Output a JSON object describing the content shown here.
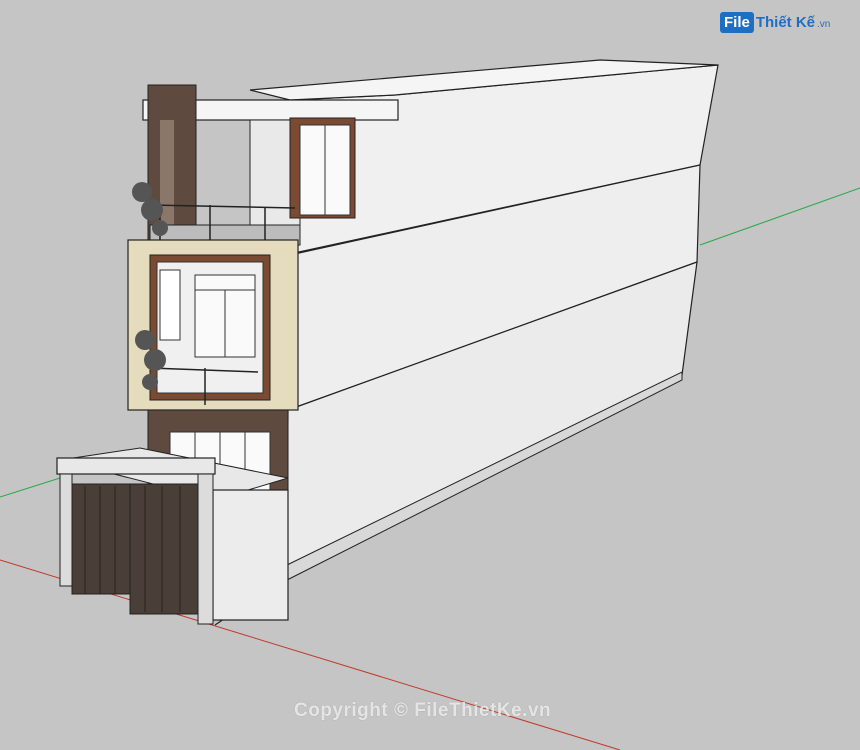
{
  "logo": {
    "badge": "File",
    "rest": "Thiết Kế",
    "tld": ".vn"
  },
  "watermark": "Copyright © FileThietKe.vn",
  "colors": {
    "background": "#c5c5c5",
    "wall": "#f0f0f0",
    "wall_shade": "#dcdcdc",
    "beige": "#e4dcbc",
    "wood": "#7a4a33",
    "stone": "#5e4a3e",
    "axis_red": "#c0392b",
    "axis_green": "#2aa84a",
    "brand": "#1e6fc4"
  }
}
